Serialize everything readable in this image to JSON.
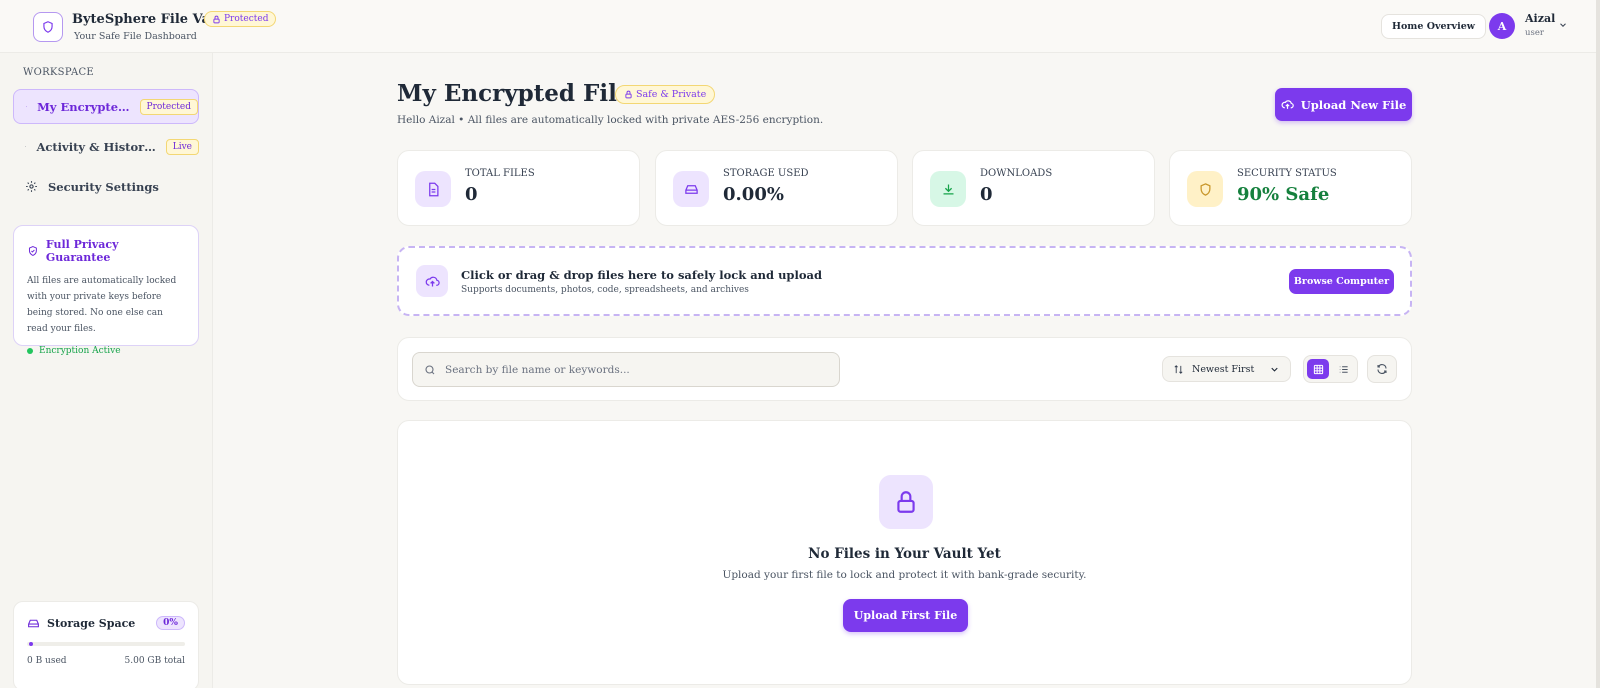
{
  "header": {
    "app_title": "ByteSphere File Vault",
    "app_subtitle": "Your Safe File Dashboard",
    "protected_badge": "Protected",
    "home_button": "Home Overview",
    "user": {
      "initial": "A",
      "name": "Aizal",
      "role": "user"
    }
  },
  "sidebar": {
    "section_label": "WORKSPACE",
    "items": [
      {
        "label": "My Encrypte…",
        "badge": "Protected",
        "active": true,
        "icon": "folder-lock-icon"
      },
      {
        "label": "Activity & Histor…",
        "badge": "Live",
        "active": false,
        "icon": "activity-icon"
      },
      {
        "label": "Security Settings",
        "badge": "",
        "active": false,
        "icon": "gear-icon"
      }
    ],
    "privacy": {
      "title": "Full Privacy Guarantee",
      "text": "All files are automatically locked with your private keys before being stored. No one else can read your files.",
      "status": "Encryption Active"
    },
    "storage": {
      "title": "Storage Space",
      "percent_label": "0%",
      "used_fraction": 0,
      "used": "0 B used",
      "total": "5.00 GB total"
    }
  },
  "main": {
    "title": "My Encrypted Files",
    "title_badge": "Safe & Private",
    "subtitle": "Hello Aizal • All files are automatically locked with private AES-256 encryption.",
    "upload_button": "Upload New File",
    "stats": [
      {
        "label": "TOTAL FILES",
        "value": "0",
        "icon": "file-icon",
        "icon_bg": "#ede4fe",
        "icon_color": "#7c3aed"
      },
      {
        "label": "STORAGE USED",
        "value": "0.00%",
        "icon": "drive-icon",
        "icon_bg": "#ede4fe",
        "icon_color": "#7c3aed"
      },
      {
        "label": "DOWNLOADS",
        "value": "0",
        "icon": "download-icon",
        "icon_bg": "#d7f7e6",
        "icon_color": "#16a34a"
      },
      {
        "label": "SECURITY STATUS",
        "value": "90% Safe",
        "icon": "shield-icon",
        "icon_bg": "#fff1c7",
        "icon_color": "#c8962a"
      }
    ],
    "dropzone": {
      "title": "Click or drag & drop files here to safely lock and upload",
      "subtitle": "Supports documents, photos, code, spreadsheets, and archives",
      "button": "Browse Computer"
    },
    "search": {
      "placeholder": "Search by file name or keywords...",
      "value": ""
    },
    "sort": {
      "selected": "Newest First"
    },
    "empty": {
      "title": "No Files in Your Vault Yet",
      "subtitle": "Upload your first file to lock and protect it with bank-grade security.",
      "button": "Upload First File"
    }
  },
  "colors": {
    "accent": "#7c3aed",
    "accent_light": "#ede4fe",
    "success": "#15803d",
    "warning_bg": "#fff7d6"
  }
}
